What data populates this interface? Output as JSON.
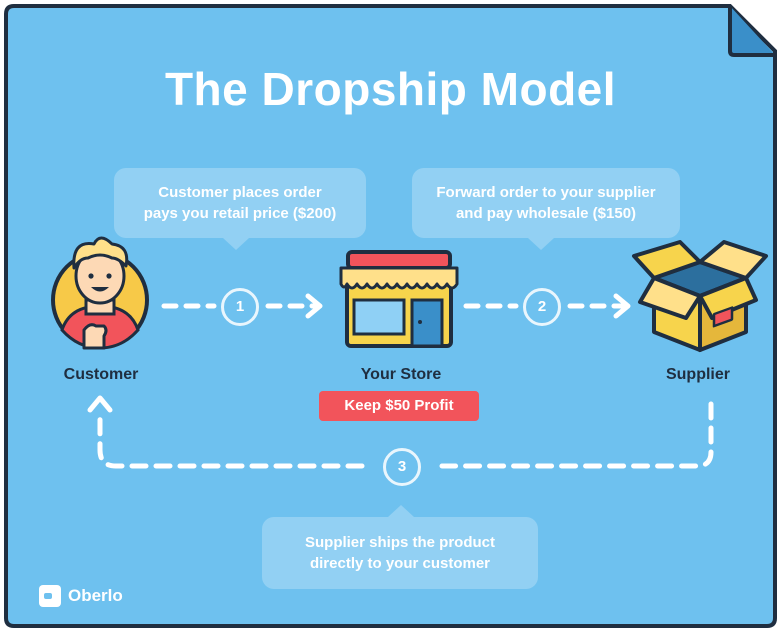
{
  "title": "The Dropship Model",
  "colors": {
    "background": "#6ec1ef",
    "border": "#1f2e40",
    "accent_red": "#f2545b",
    "dash": "#ffffff"
  },
  "bubbles": {
    "order": {
      "line1": "Customer places order",
      "line2": "pays you retail price ($200)"
    },
    "forward": {
      "line1": "Forward order to your supplier",
      "line2": "and pay wholesale ($150)"
    },
    "ship": {
      "line1": "Supplier ships the product",
      "line2": "directly to your customer"
    }
  },
  "nodes": {
    "customer": {
      "label": "Customer",
      "icon": "customer-avatar-icon"
    },
    "store": {
      "label": "Your Store",
      "icon": "storefront-icon"
    },
    "supplier": {
      "label": "Supplier",
      "icon": "open-box-icon"
    }
  },
  "steps": [
    "1",
    "2",
    "3"
  ],
  "profit_badge": "Keep $50 Profit",
  "brand": {
    "name": "Oberlo",
    "icon": "oberlo-logo-icon"
  }
}
